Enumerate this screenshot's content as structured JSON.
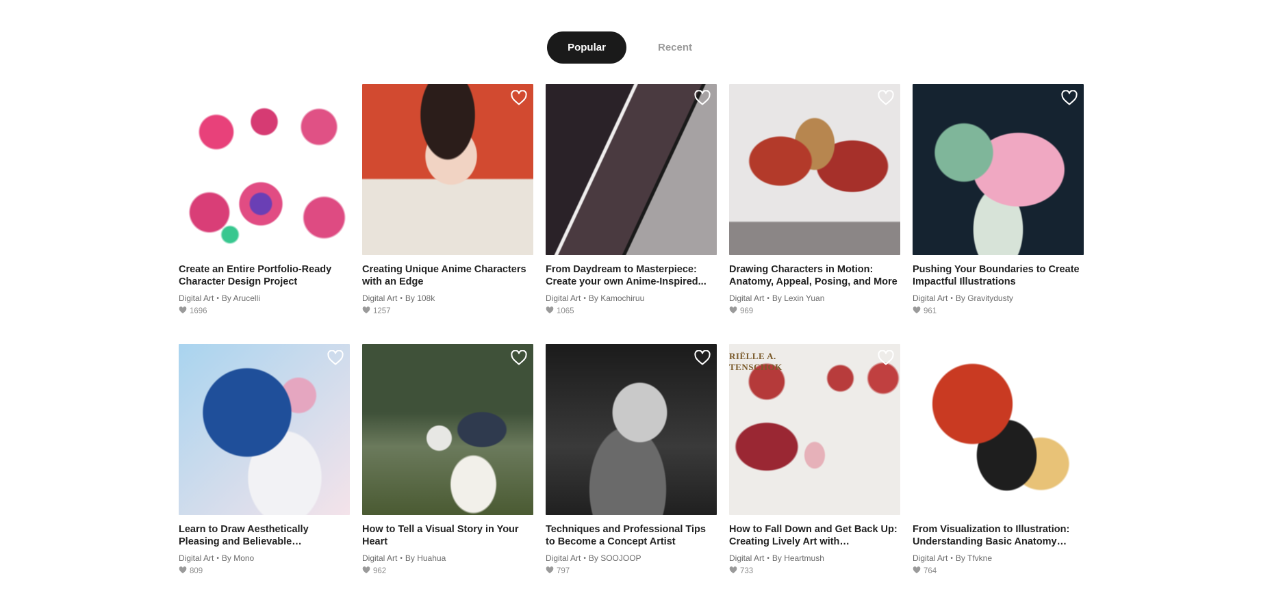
{
  "tabs": [
    {
      "label": "Popular",
      "active": true
    },
    {
      "label": "Recent",
      "active": false
    }
  ],
  "cards": [
    {
      "title": "Create an Entire Portfolio-Ready Character Design Project",
      "category": "Digital Art",
      "author": "By Arucelli",
      "likes": "1696",
      "art": "art1",
      "fav": false
    },
    {
      "title": "Creating Unique Anime Characters with an Edge",
      "category": "Digital Art",
      "author": "By 108k",
      "likes": "1257",
      "art": "art2",
      "fav": true
    },
    {
      "title": "From Daydream to Masterpiece: Create your own Anime-Inspired...",
      "category": "Digital Art",
      "author": "By Kamochiruu",
      "likes": "1065",
      "art": "art3",
      "fav": true
    },
    {
      "title": "Drawing Characters in Motion: Anatomy, Appeal, Posing, and More",
      "category": "Digital Art",
      "author": "By Lexin Yuan",
      "likes": "969",
      "art": "art4",
      "fav": true
    },
    {
      "title": "Pushing Your Boundaries to Create Impactful Illustrations",
      "category": "Digital Art",
      "author": "By Gravitydusty",
      "likes": "961",
      "art": "art5",
      "fav": true
    },
    {
      "title": "Learn to Draw Aesthetically Pleasing and Believable Illustrations Using...",
      "category": "Digital Art",
      "author": "By Mono",
      "likes": "809",
      "art": "art6",
      "fav": true
    },
    {
      "title": "How to Tell a Visual Story in Your Heart",
      "category": "Digital Art",
      "author": "By Huahua",
      "likes": "962",
      "art": "art7",
      "fav": true
    },
    {
      "title": "Techniques and Professional Tips to Become a Concept Artist",
      "category": "Digital Art",
      "author": "By SOOJOOP",
      "likes": "797",
      "art": "art8",
      "fav": true
    },
    {
      "title": "How to Fall Down and Get Back Up: Creating Lively Art with HEARTMUSH",
      "category": "Digital Art",
      "author": "By Heartmush",
      "likes": "733",
      "art": "art9",
      "fav": true,
      "art_text": "RIËLLE A.\nTENSCHOK"
    },
    {
      "title": "From Visualization to Illustration: Understanding Basic Anatomy and...",
      "category": "Digital Art",
      "author": "By Tfvkne",
      "likes": "764",
      "art": "art10",
      "fav": false
    }
  ],
  "meta_separator": "•",
  "icons": {
    "favorite": "heart-outline-icon",
    "likes": "heart-filled-icon"
  }
}
